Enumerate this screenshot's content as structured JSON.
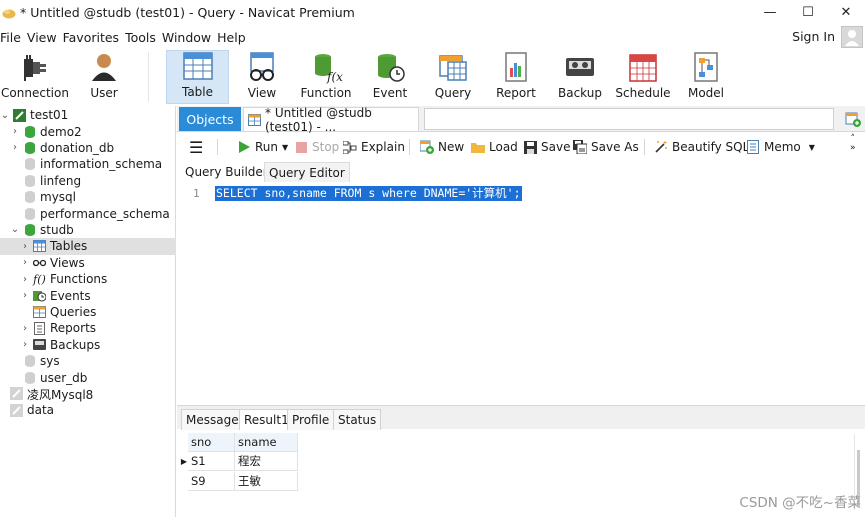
{
  "window": {
    "title": "* Untitled @studb (test01) - Query - Navicat Premium",
    "controls": [
      "minimize",
      "maximize",
      "close"
    ]
  },
  "menu": [
    "File",
    "View",
    "Favorites",
    "Tools",
    "Window",
    "Help"
  ],
  "account": {
    "signin_label": "Sign In"
  },
  "toolbar": {
    "items": [
      {
        "label": "Connection",
        "icon": "connection-icon"
      },
      {
        "label": "User",
        "icon": "user-icon"
      },
      {
        "label": "Table",
        "icon": "table-icon",
        "active": true
      },
      {
        "label": "View",
        "icon": "view-icon"
      },
      {
        "label": "Function",
        "icon": "function-icon"
      },
      {
        "label": "Event",
        "icon": "event-icon"
      },
      {
        "label": "Query",
        "icon": "query-icon"
      },
      {
        "label": "Report",
        "icon": "report-icon"
      },
      {
        "label": "Backup",
        "icon": "backup-icon"
      },
      {
        "label": "Schedule",
        "icon": "schedule-icon"
      },
      {
        "label": "Model",
        "icon": "model-icon"
      }
    ]
  },
  "navigator": {
    "items": [
      {
        "label": "test01",
        "level": 0,
        "expanded": true,
        "icon": "connection-icon"
      },
      {
        "label": "demo2",
        "level": 1,
        "expanded": false,
        "icon": "database-icon"
      },
      {
        "label": "donation_db",
        "level": 1,
        "expanded": false,
        "icon": "database-icon"
      },
      {
        "label": "information_schema",
        "level": 1,
        "icon": "database-closed-icon"
      },
      {
        "label": "linfeng",
        "level": 1,
        "icon": "database-closed-icon"
      },
      {
        "label": "mysql",
        "level": 1,
        "icon": "database-closed-icon"
      },
      {
        "label": "performance_schema",
        "level": 1,
        "icon": "database-closed-icon"
      },
      {
        "label": "studb",
        "level": 1,
        "expanded": true,
        "icon": "database-icon"
      },
      {
        "label": "Tables",
        "level": 2,
        "expanded": false,
        "icon": "tables-icon",
        "selected": true
      },
      {
        "label": "Views",
        "level": 2,
        "expanded": false,
        "icon": "views-icon"
      },
      {
        "label": "Functions",
        "level": 2,
        "expanded": false,
        "icon": "functions-icon"
      },
      {
        "label": "Events",
        "level": 2,
        "expanded": false,
        "icon": "events-icon"
      },
      {
        "label": "Queries",
        "level": 2,
        "icon": "queries-icon"
      },
      {
        "label": "Reports",
        "level": 2,
        "expanded": false,
        "icon": "reports-icon"
      },
      {
        "label": "Backups",
        "level": 2,
        "expanded": false,
        "icon": "backups-icon"
      },
      {
        "label": "sys",
        "level": 1,
        "icon": "database-closed-icon"
      },
      {
        "label": "user_db",
        "level": 1,
        "icon": "database-closed-icon"
      },
      {
        "label": "凌风Mysql8",
        "level": 0,
        "icon": "connection-closed-icon"
      },
      {
        "label": "data",
        "level": 0,
        "icon": "connection-closed-icon"
      }
    ]
  },
  "tabs": {
    "objects_label": "Objects",
    "query_tab_label": "* Untitled @studb (test01) - ..."
  },
  "query_toolbar": {
    "run_label": "Run",
    "stop_label": "Stop",
    "explain_label": "Explain",
    "new_label": "New",
    "load_label": "Load",
    "save_label": "Save",
    "save_as_label": "Save As",
    "beautify_label": "Beautify SQL",
    "memo_label": "Memo"
  },
  "editor_tabs": [
    "Query Builder",
    "Query Editor"
  ],
  "editor": {
    "line_number": "1",
    "sql": "SELECT sno,sname FROM s where DNAME='计算机';"
  },
  "result_tabs": [
    "Message",
    "Result1",
    "Profile",
    "Status"
  ],
  "result": {
    "columns": [
      "sno",
      "sname"
    ],
    "rows": [
      [
        "S1",
        "程宏"
      ],
      [
        "S9",
        "王敏"
      ]
    ]
  },
  "watermark": "CSDN @不吃~香菜"
}
